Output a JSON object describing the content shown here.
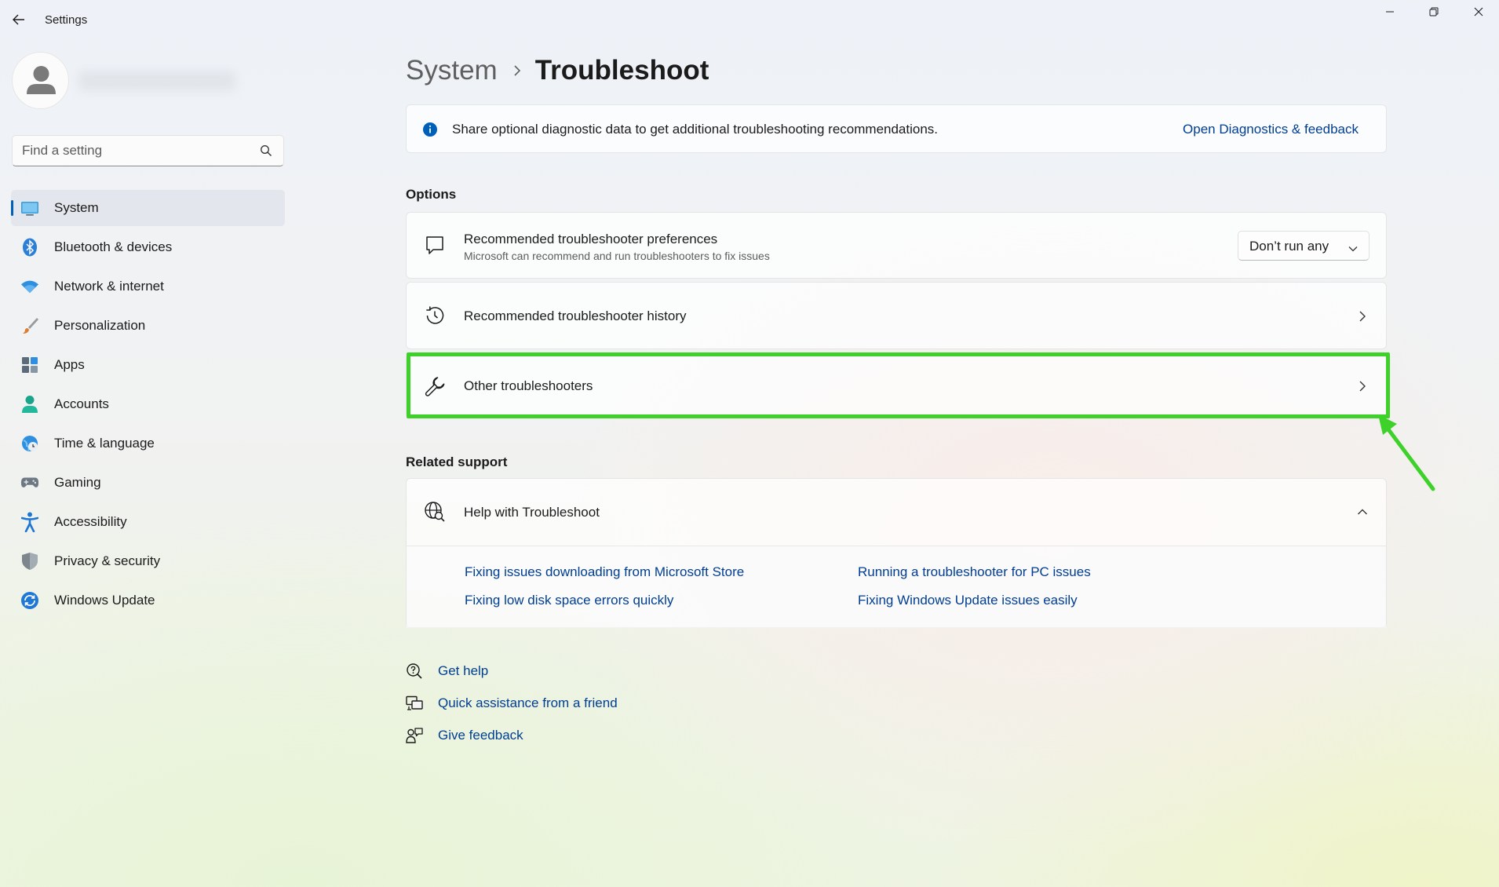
{
  "window": {
    "title": "Settings",
    "back_icon": "arrow-left-icon",
    "minimize_icon": "minimize-icon",
    "maximize_icon": "restore-icon",
    "close_icon": "close-icon"
  },
  "sidebar": {
    "search_placeholder": "Find a setting",
    "items": [
      {
        "label": "System",
        "icon": "monitor-icon",
        "active": true
      },
      {
        "label": "Bluetooth & devices",
        "icon": "bluetooth-icon",
        "active": false
      },
      {
        "label": "Network & internet",
        "icon": "wifi-icon",
        "active": false
      },
      {
        "label": "Personalization",
        "icon": "brush-icon",
        "active": false
      },
      {
        "label": "Apps",
        "icon": "apps-icon",
        "active": false
      },
      {
        "label": "Accounts",
        "icon": "person-icon",
        "active": false
      },
      {
        "label": "Time & language",
        "icon": "globe-clock-icon",
        "active": false
      },
      {
        "label": "Gaming",
        "icon": "gamepad-icon",
        "active": false
      },
      {
        "label": "Accessibility",
        "icon": "accessibility-icon",
        "active": false
      },
      {
        "label": "Privacy & security",
        "icon": "shield-icon",
        "active": false
      },
      {
        "label": "Windows Update",
        "icon": "update-icon",
        "active": false
      }
    ]
  },
  "breadcrumb": {
    "parent": "System",
    "current": "Troubleshoot"
  },
  "info_bar": {
    "text": "Share optional diagnostic data to get additional troubleshooting recommendations.",
    "link": "Open Diagnostics & feedback"
  },
  "options": {
    "heading": "Options",
    "prefs": {
      "title": "Recommended troubleshooter preferences",
      "subtitle": "Microsoft can recommend and run troubleshooters to fix issues",
      "dropdown_value": "Don’t run any"
    },
    "history": {
      "title": "Recommended troubleshooter history"
    },
    "other": {
      "title": "Other troubleshooters"
    }
  },
  "related": {
    "heading": "Related support",
    "help_title": "Help with Troubleshoot",
    "links": [
      "Fixing issues downloading from Microsoft Store",
      "Running a troubleshooter for PC issues",
      "Fixing low disk space errors quickly",
      "Fixing Windows Update issues easily"
    ]
  },
  "support_links": {
    "get_help": "Get help",
    "quick_assist": "Quick assistance from a friend",
    "feedback": "Give feedback"
  },
  "colors": {
    "accent": "#005fb8",
    "link": "#003e92",
    "highlight": "#3ed12a"
  }
}
